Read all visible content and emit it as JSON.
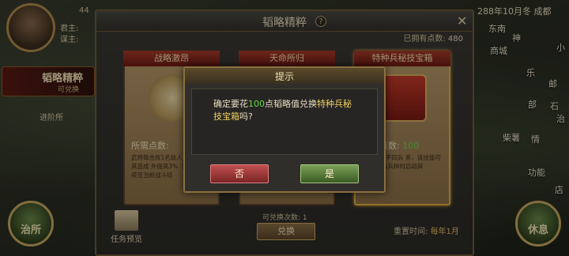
{
  "hud": {
    "lord_label": "君主:",
    "counsel_label": "谋主:",
    "top_value": "44",
    "date": "288年10月冬 成都",
    "side_item": {
      "title": "韬略精粹",
      "sub": "可兑换"
    },
    "jinjie": "进阶所",
    "left_round": "治所",
    "right_round": "休息",
    "map_labels": [
      "东南",
      "商城",
      "小",
      "神",
      "乐",
      "邮",
      "部",
      "石",
      "治",
      "柴薯",
      "情",
      "功能",
      "店"
    ]
  },
  "panel": {
    "title": "韬略精粹",
    "help": "?",
    "owned_label": "已拥有点数:",
    "owned_value": "480",
    "cards": [
      {
        "title": "战略激昂",
        "cost_label": "所需点数:",
        "cost_value": "",
        "desc": "武将每击败1名敌人 本场战斗中其造成 外提高3%（可叠加 持续至当前战斗结"
      },
      {
        "title": "天命所归",
        "cost_label": "",
        "cost_value": "",
        "desc": ""
      },
      {
        "title": "特种兵秘技宝箱",
        "cost_label": "所需点数:",
        "cost_value": "100",
        "desc": "在选一个不同兵 系，该技能可以武 种兵兵种时启动其"
      }
    ],
    "remain_label": "可兑换次数:",
    "remain_value": "1",
    "redeem": "兑换",
    "reset_label": "重置时间:",
    "reset_value": "每年1月",
    "task_preview": "任务预览"
  },
  "dialog": {
    "title": "提示",
    "msg_pre": "确定要花",
    "msg_points": "100",
    "msg_mid": "点韬略值兑换",
    "msg_item": "特种兵秘技宝箱",
    "msg_post": "吗?",
    "no": "否",
    "yes": "是"
  },
  "colors": {
    "green": "#6ad84a",
    "gold": "#f0d060",
    "no_button": "#a03a3a",
    "yes_button": "#5a8040"
  }
}
